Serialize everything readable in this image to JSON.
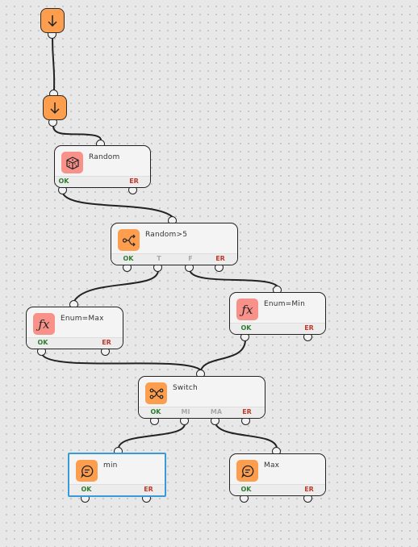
{
  "colors": {
    "accent_orange": "#fd9e4e",
    "accent_red": "#f7918a",
    "ok": "#2e7d32",
    "error": "#c0392b",
    "selection": "#3a9ad9"
  },
  "start_nodes": [
    {
      "icon": "arrow-down-icon"
    },
    {
      "icon": "arrow-down-icon"
    }
  ],
  "nodes": {
    "random": {
      "title": "Random",
      "icon": "dice-icon",
      "ports": [
        "OK",
        "ER"
      ]
    },
    "random_gt5": {
      "title": "Random>5",
      "icon": "branch-icon",
      "ports": [
        "OK",
        "T",
        "F",
        "ER"
      ]
    },
    "enum_max": {
      "title": "Enum=Max",
      "icon": "function-icon",
      "ports": [
        "OK",
        "ER"
      ]
    },
    "enum_min": {
      "title": "Enum=Min",
      "icon": "function-icon",
      "ports": [
        "OK",
        "ER"
      ]
    },
    "switch": {
      "title": "Switch",
      "icon": "switch-icon",
      "ports": [
        "OK",
        "MI",
        "MA",
        "ER"
      ]
    },
    "msg_min": {
      "title": "min",
      "icon": "chat-icon",
      "ports": [
        "OK",
        "ER"
      ],
      "selected": true
    },
    "msg_max": {
      "title": "Max",
      "icon": "chat-icon",
      "ports": [
        "OK",
        "ER"
      ]
    }
  },
  "connections": [
    {
      "from": "start-1",
      "to": "start-2"
    },
    {
      "from": "start-2",
      "to": "random"
    },
    {
      "from": "random.OK",
      "to": "random_gt5"
    },
    {
      "from": "random_gt5.T",
      "to": "enum_max"
    },
    {
      "from": "random_gt5.F",
      "to": "enum_min"
    },
    {
      "from": "enum_max.OK",
      "to": "switch"
    },
    {
      "from": "enum_min.OK",
      "to": "switch"
    },
    {
      "from": "switch.MI",
      "to": "msg_min"
    },
    {
      "from": "switch.MA",
      "to": "msg_max"
    }
  ]
}
